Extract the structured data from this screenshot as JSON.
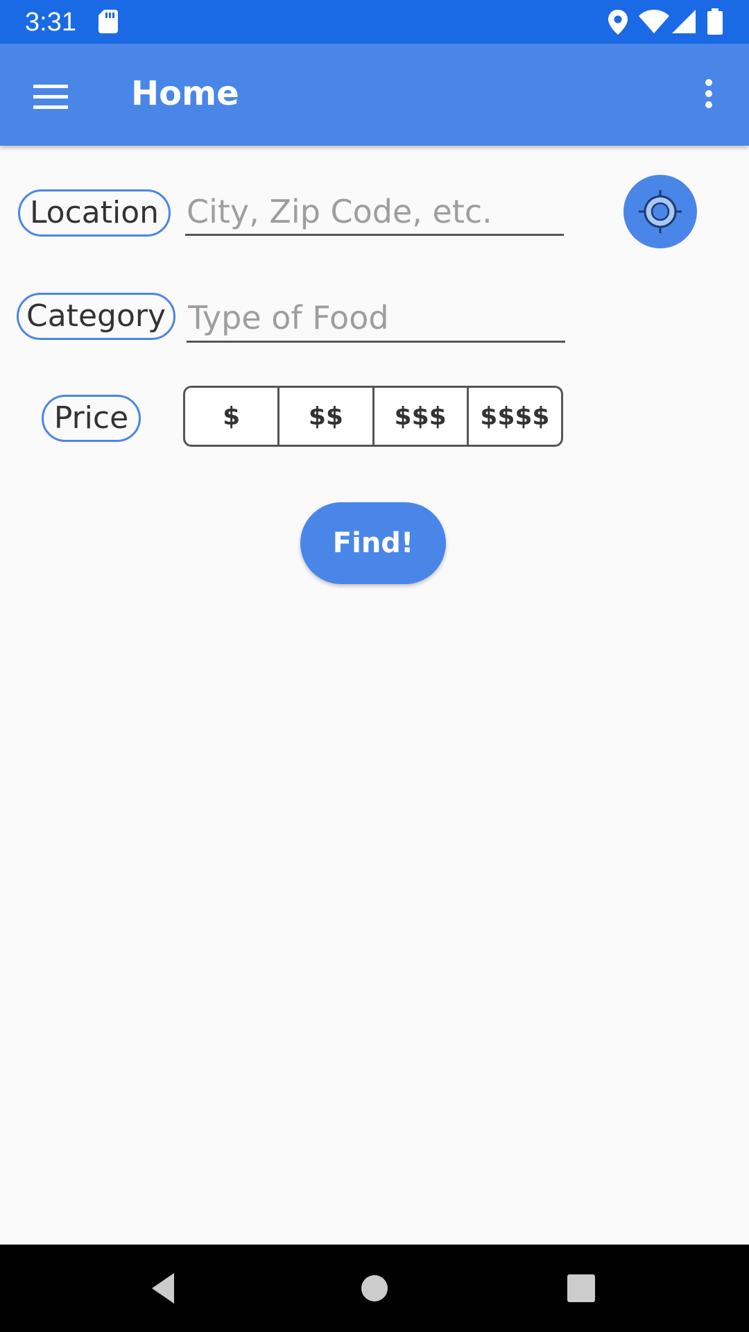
{
  "status_bar": {
    "time": "3:31",
    "icons": [
      "sd-card-icon",
      "location-pin-icon",
      "wifi-icon",
      "cell-signal-icon",
      "battery-icon"
    ]
  },
  "app_bar": {
    "menu_icon": "hamburger-menu-icon",
    "title": "Home",
    "overflow_icon": "more-vert-icon"
  },
  "form": {
    "location": {
      "label": "Location",
      "value": "",
      "placeholder": "City, Zip Code, etc."
    },
    "locate_button_icon": "my-location-icon",
    "category": {
      "label": "Category",
      "value": "",
      "placeholder": "Type of Food"
    },
    "price": {
      "label": "Price",
      "options": [
        "$",
        "$$",
        "$$$",
        "$$$$"
      ]
    },
    "find_label": "Find!"
  },
  "nav_bar": {
    "icons": [
      "back-icon",
      "home-icon",
      "recents-icon"
    ]
  },
  "colors": {
    "status_bar": "#1a6ae6",
    "app_bar": "#4a86e8",
    "accent": "#4a86e8",
    "background": "#fafafa",
    "nav_bar": "#000000"
  }
}
